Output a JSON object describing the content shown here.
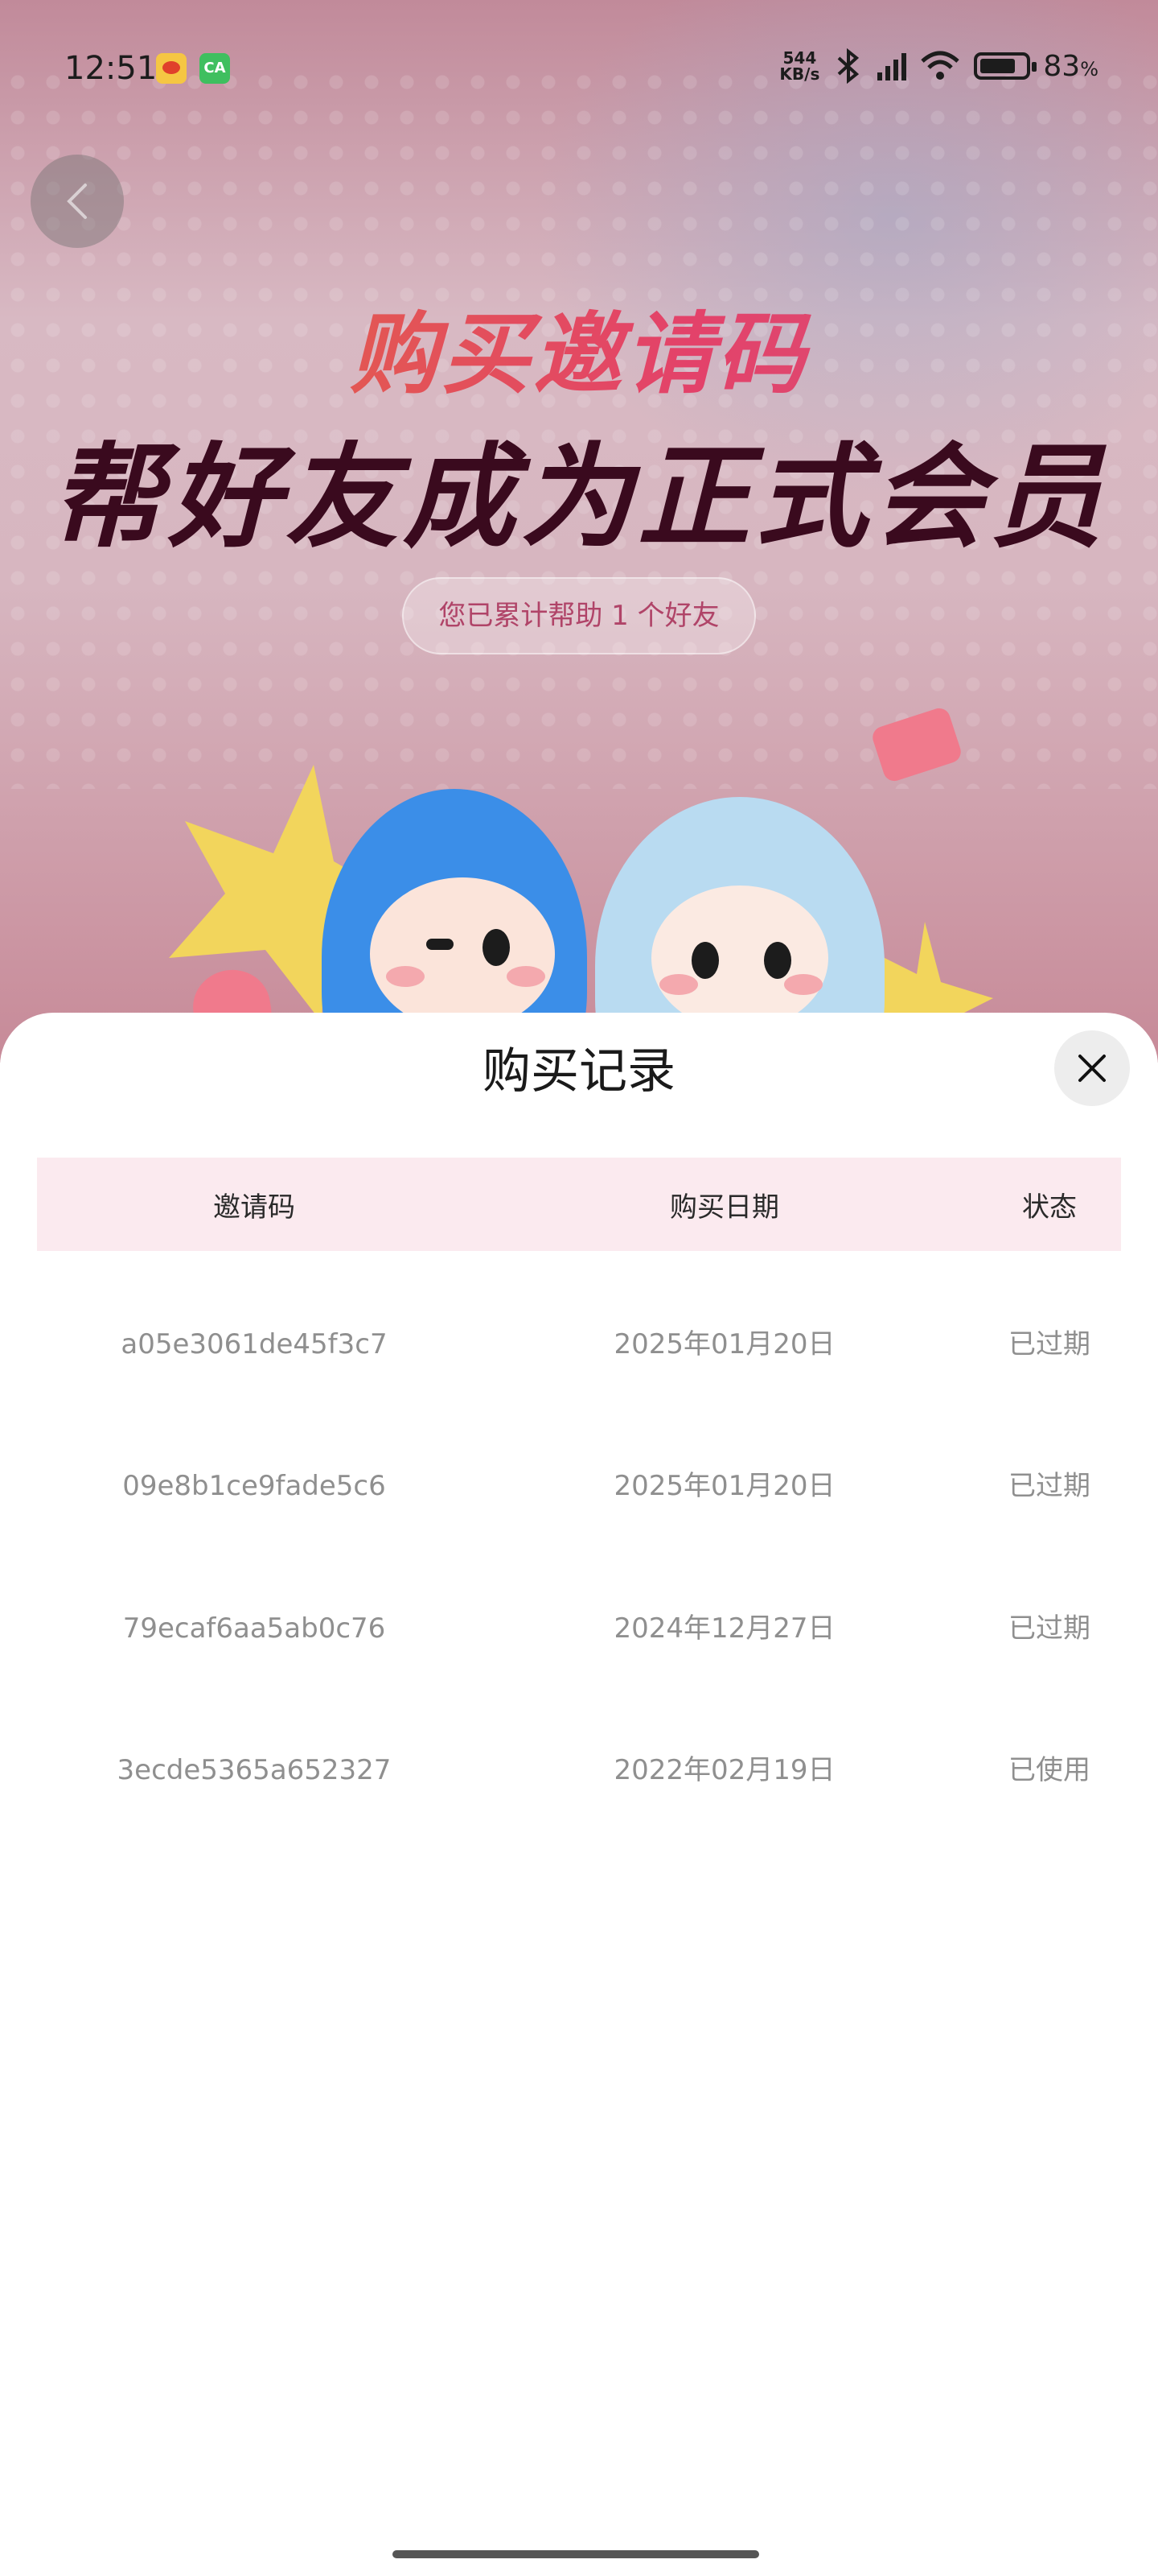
{
  "status_bar": {
    "time": "12:51",
    "net_speed_top": "544",
    "net_speed_bottom": "KB/s",
    "battery": "83",
    "battery_unit": "%",
    "app_icons": [
      "weibo-icon",
      "ca-app-icon"
    ],
    "ca_label": "CA"
  },
  "hero": {
    "title": "购买邀请码",
    "subtitle": "帮好友成为正式会员",
    "helped_text": "您已累计帮助 1 个好友"
  },
  "sheet": {
    "title": "购买记录",
    "columns": [
      "邀请码",
      "购买日期",
      "状态"
    ],
    "rows": [
      {
        "code": "a05e3061de45f3c7",
        "date": "2025年01月20日",
        "status": "已过期"
      },
      {
        "code": "09e8b1ce9fade5c6",
        "date": "2025年01月20日",
        "status": "已过期"
      },
      {
        "code": "79ecaf6aa5ab0c76",
        "date": "2024年12月27日",
        "status": "已过期"
      },
      {
        "code": "3ecde5365a652327",
        "date": "2022年02月19日",
        "status": "已使用"
      }
    ]
  },
  "colors": {
    "header_bg": "#fbeaef",
    "title_gradient_start": "#e36c3c",
    "title_gradient_end": "#e3426a",
    "subtitle": "#3a0a1e",
    "helped_text": "#b04468"
  }
}
